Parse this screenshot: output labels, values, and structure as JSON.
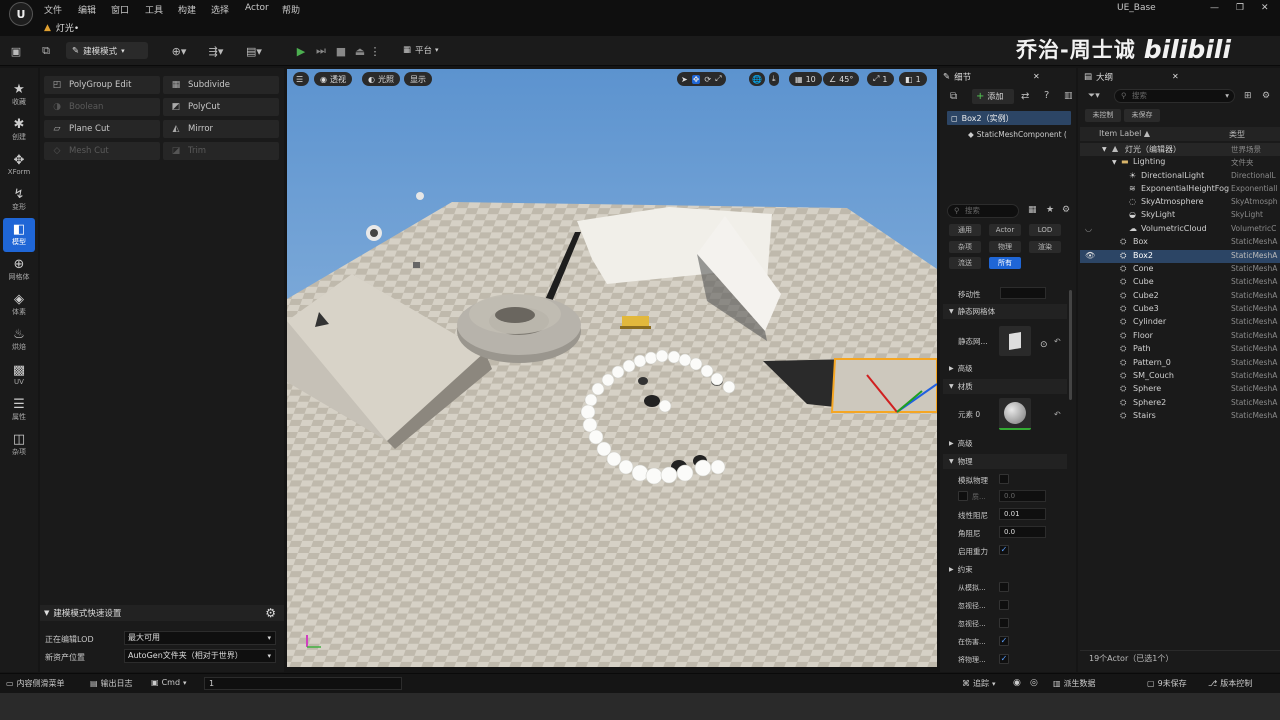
{
  "menu": {
    "items": [
      "文件",
      "编辑",
      "窗口",
      "工具",
      "构建",
      "选择",
      "Actor",
      "帮助"
    ],
    "project": "UE_Base"
  },
  "tab": {
    "label": "灯光•"
  },
  "watermark": {
    "text": "乔治-周士诚",
    "logo": "bilibili"
  },
  "toolbar": {
    "mode": "建模模式",
    "platform": "平台"
  },
  "left_strip": [
    {
      "label": "收藏",
      "icon": "star-icon",
      "glyph": "★"
    },
    {
      "label": "创建",
      "icon": "create-icon",
      "glyph": "✱"
    },
    {
      "label": "XForm",
      "icon": "xform-icon",
      "glyph": "✥"
    },
    {
      "label": "变形",
      "icon": "deform-icon",
      "glyph": "↯"
    },
    {
      "label": "模型",
      "icon": "model-icon",
      "glyph": "◧"
    },
    {
      "label": "网格体",
      "icon": "mesh-icon",
      "glyph": "⊕"
    },
    {
      "label": "体素",
      "icon": "voxel-icon",
      "glyph": "◈"
    },
    {
      "label": "烘焙",
      "icon": "bake-icon",
      "glyph": "♨"
    },
    {
      "label": "UV",
      "icon": "uv-icon",
      "glyph": "▩"
    },
    {
      "label": "属性",
      "icon": "attributes-icon",
      "glyph": "☰"
    },
    {
      "label": "杂项",
      "icon": "misc-icon",
      "glyph": "◫"
    }
  ],
  "tools": [
    {
      "label": "PolyGroup Edit",
      "enabled": true
    },
    {
      "label": "Subdivide",
      "enabled": true
    },
    {
      "label": "Boolean",
      "enabled": false
    },
    {
      "label": "PolyCut",
      "enabled": true
    },
    {
      "label": "Plane Cut",
      "enabled": true
    },
    {
      "label": "Mirror",
      "enabled": true
    },
    {
      "label": "Mesh Cut",
      "enabled": false
    },
    {
      "label": "Trim",
      "enabled": false
    }
  ],
  "quick_settings": {
    "title": "建模模式快速设置",
    "lod_label": "正在编辑LOD",
    "lod_value": "最大可用",
    "asset_label": "新资产位置",
    "asset_value": "AutoGen文件夹（相对于世界）"
  },
  "viewport": {
    "perspective": "透视",
    "lit": "光照",
    "show": "显示",
    "grid": "10",
    "angle": "45°",
    "scale": "1",
    "cam": "1"
  },
  "details": {
    "tab": "细节",
    "add": "添加",
    "instance": "Box2（实例）",
    "component": "StaticMeshComponent (",
    "search_placeholder": "搜索",
    "categories": [
      "通用",
      "Actor",
      "LOD",
      "杂项",
      "物理",
      "渲染",
      "流送",
      "所有"
    ],
    "mobility": "移动性",
    "static_mesh_section": "静态网格体",
    "static_mesh_label": "静态网...",
    "advanced": "高级",
    "materials": "材质",
    "element0": "元素 0",
    "physics": "物理",
    "simulate": "模拟物理",
    "mass_value": "0.0",
    "mass_label": "质...",
    "linear_damping_label": "线性阻尼",
    "linear_damping": "0.01",
    "angular_damping_label": "角阻尼",
    "angular_damping": "0.0",
    "gravity_label": "启用重力",
    "constraints": "约束",
    "c1": "从模拟...",
    "c2": "忽视径...",
    "c3": "忽视径...",
    "c4": "在伤害...",
    "c5": "将物理..."
  },
  "outliner": {
    "tab": "大纲",
    "search_placeholder": "搜索",
    "unsaved": "未保存",
    "uncontrolled": "未控制",
    "col_label": "Item Label ▲",
    "col_type": "类型",
    "rows": [
      {
        "label": "灯光（编辑器）",
        "type": "世界场景",
        "indent": 0,
        "icon": "world"
      },
      {
        "label": "Lighting",
        "type": "文件夹",
        "indent": 1,
        "icon": "folder"
      },
      {
        "label": "DirectionalLight",
        "type": "DirectionalL",
        "indent": 2,
        "icon": "light"
      },
      {
        "label": "ExponentialHeightFog",
        "type": "Exponentiall",
        "indent": 2,
        "icon": "fog"
      },
      {
        "label": "SkyAtmosphere",
        "type": "SkyAtmosph",
        "indent": 2,
        "icon": "sky"
      },
      {
        "label": "SkyLight",
        "type": "SkyLight",
        "indent": 2,
        "icon": "skylight"
      },
      {
        "label": "VolumetricCloud",
        "type": "VolumetricC",
        "indent": 2,
        "icon": "cloud"
      },
      {
        "label": "Box",
        "type": "StaticMeshA",
        "indent": 1,
        "icon": "mesh"
      },
      {
        "label": "Box2",
        "type": "StaticMeshA",
        "indent": 1,
        "icon": "mesh",
        "selected": true
      },
      {
        "label": "Cone",
        "type": "StaticMeshA",
        "indent": 1,
        "icon": "mesh"
      },
      {
        "label": "Cube",
        "type": "StaticMeshA",
        "indent": 1,
        "icon": "mesh"
      },
      {
        "label": "Cube2",
        "type": "StaticMeshA",
        "indent": 1,
        "icon": "mesh"
      },
      {
        "label": "Cube3",
        "type": "StaticMeshA",
        "indent": 1,
        "icon": "mesh"
      },
      {
        "label": "Cylinder",
        "type": "StaticMeshA",
        "indent": 1,
        "icon": "mesh"
      },
      {
        "label": "Floor",
        "type": "StaticMeshA",
        "indent": 1,
        "icon": "mesh"
      },
      {
        "label": "Path",
        "type": "StaticMeshA",
        "indent": 1,
        "icon": "mesh"
      },
      {
        "label": "Pattern_0",
        "type": "StaticMeshA",
        "indent": 1,
        "icon": "mesh"
      },
      {
        "label": "SM_Couch",
        "type": "StaticMeshA",
        "indent": 1,
        "icon": "mesh"
      },
      {
        "label": "Sphere",
        "type": "StaticMeshA",
        "indent": 1,
        "icon": "mesh"
      },
      {
        "label": "Sphere2",
        "type": "StaticMeshA",
        "indent": 1,
        "icon": "mesh"
      },
      {
        "label": "Stairs",
        "type": "StaticMeshA",
        "indent": 1,
        "icon": "mesh"
      }
    ],
    "footer": "19个Actor（已选1个）"
  },
  "statusbar": {
    "drawer": "内容侧滑菜单",
    "log": "输出日志",
    "cmd": "Cmd",
    "cmd_value": "1",
    "trace": "追踪",
    "derived": "派生数据",
    "unsaved": "9未保存",
    "source": "版本控制"
  }
}
